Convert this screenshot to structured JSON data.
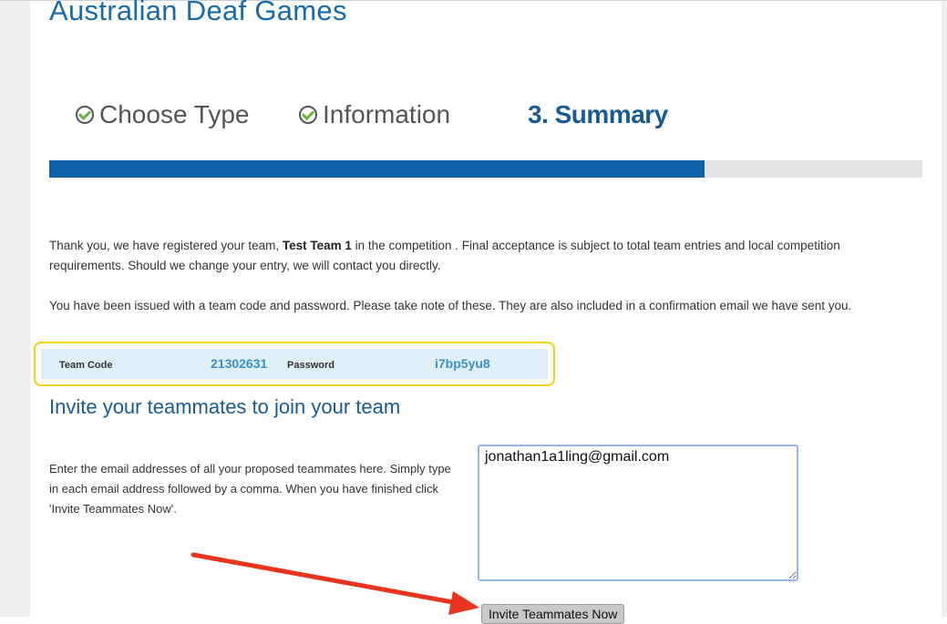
{
  "page": {
    "title": "Australian Deaf Games"
  },
  "steps": [
    {
      "label": "Choose Type",
      "state": "done"
    },
    {
      "label": "Information",
      "state": "done"
    },
    {
      "label": "3. Summary",
      "state": "active"
    }
  ],
  "progress": {
    "fraction": 0.75
  },
  "summary": {
    "para1_prefix": "Thank you, we have registered your team, ",
    "team_name": "Test Team 1",
    "para1_suffix": " in the competition . Final acceptance is subject to total team entries and local competition requirements. Should we change your entry, we will contact you directly.",
    "para2": "You have been issued with a team code and password. Please take note of these. They are also included in a confirmation email we have sent you."
  },
  "credentials": {
    "team_code_label": "Team Code",
    "team_code": "21302631",
    "password_label": "Password",
    "password": "i7bp5yu8"
  },
  "invite": {
    "title": "Invite your teammates to join your team",
    "instructions": "Enter the email addresses of all your proposed teammates here. Simply type in each email address followed by a comma. When you have finished click 'Invite Teammates Now'.",
    "emails_value": "jonathan1a1ling@gmail.com",
    "button_label": "Invite Teammates Now"
  },
  "colors": {
    "brand_blue": "#1a6aa8",
    "progress_blue": "#0d62aa",
    "highlight_yellow": "#f3d21b",
    "arrow_red": "#e8341c",
    "check_green": "#6cb33f"
  }
}
